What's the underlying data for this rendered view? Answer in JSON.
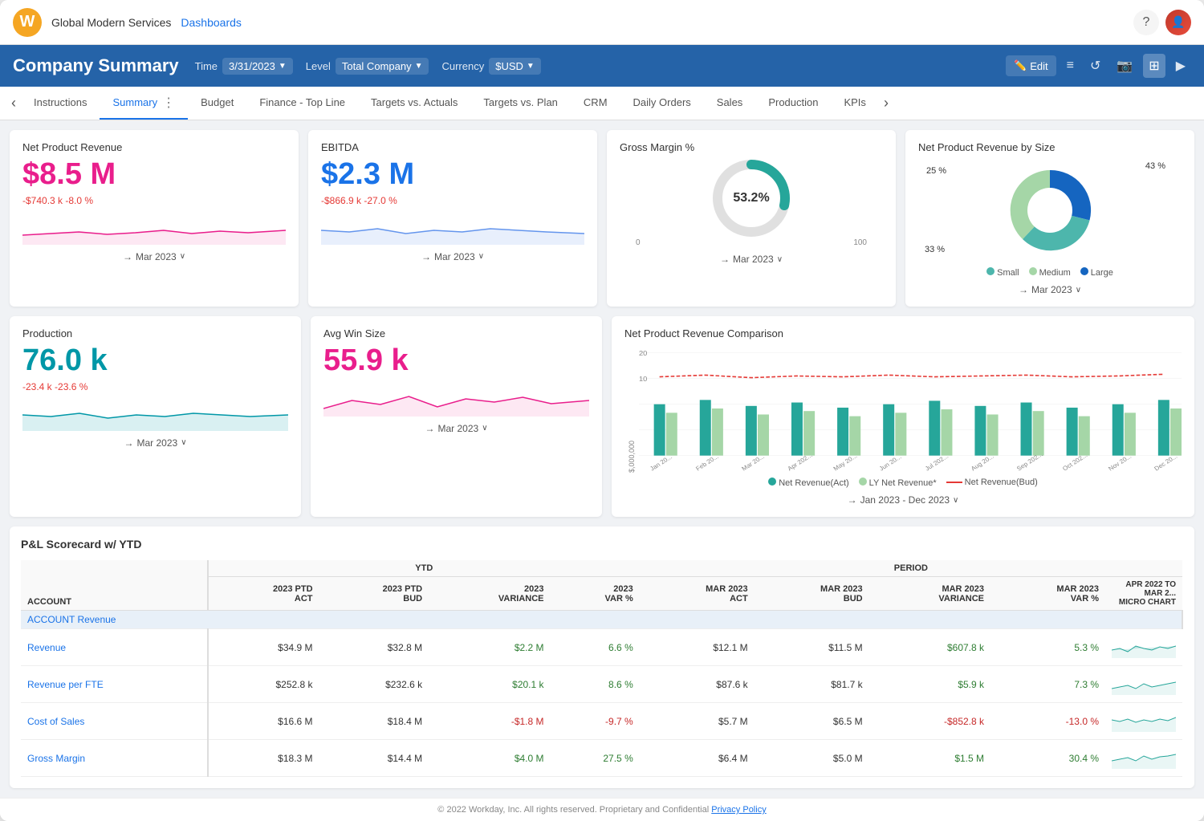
{
  "app": {
    "company": "Global Modern Services",
    "dashboards_link": "Dashboards"
  },
  "header": {
    "title": "Company Summary",
    "time_label": "Time",
    "time_value": "3/31/2023",
    "level_label": "Level",
    "level_value": "Total Company",
    "currency_label": "Currency",
    "currency_value": "$USD",
    "edit_label": "Edit",
    "icons": [
      "filter",
      "refresh",
      "camera",
      "grid",
      "video"
    ]
  },
  "tabs": [
    {
      "label": "Instructions",
      "active": false
    },
    {
      "label": "Summary",
      "active": true
    },
    {
      "label": "Budget",
      "active": false
    },
    {
      "label": "Finance - Top Line",
      "active": false
    },
    {
      "label": "Targets vs. Actuals",
      "active": false
    },
    {
      "label": "Targets vs. Plan",
      "active": false
    },
    {
      "label": "CRM",
      "active": false
    },
    {
      "label": "Daily Orders",
      "active": false
    },
    {
      "label": "Sales",
      "active": false
    },
    {
      "label": "Production",
      "active": false
    },
    {
      "label": "KPIs",
      "active": false
    }
  ],
  "widgets": {
    "net_product_revenue": {
      "title": "Net Product Revenue",
      "value": "$8.5 M",
      "delta1": "-$740.3 k",
      "delta2": "-8.0 %",
      "period": "Mar 2023"
    },
    "ebitda": {
      "title": "EBITDA",
      "value": "$2.3 M",
      "delta1": "-$866.9 k",
      "delta2": "-27.0 %",
      "period": "Mar 2023"
    },
    "gross_margin": {
      "title": "Gross Margin %",
      "value": "53.2%",
      "axis_min": "0",
      "axis_max": "100",
      "period": "Mar 2023"
    },
    "net_product_revenue_by_size": {
      "title": "Net Product Revenue by Size",
      "period": "Mar 2023",
      "segments": [
        {
          "label": "Small",
          "pct": 33,
          "color": "#4db6ac"
        },
        {
          "label": "Medium",
          "pct": 25,
          "color": "#a5d6a7"
        },
        {
          "label": "Large",
          "pct": 43,
          "color": "#1565c0"
        }
      ],
      "labels": {
        "top_right": "43 %",
        "top_left": "25 %",
        "bottom": "33 %"
      }
    },
    "production": {
      "title": "Production",
      "value": "76.0 k",
      "delta1": "-23.4 k",
      "delta2": "-23.6 %",
      "period": "Mar 2023"
    },
    "avg_win_size": {
      "title": "Avg Win Size",
      "value": "55.9 k",
      "period": "Mar 2023"
    },
    "net_product_revenue_comparison": {
      "title": "Net Product Revenue Comparison",
      "y_axis_label": "$,000,000",
      "y_max": 20,
      "period": "Jan 2023 - Dec 2023",
      "legend": [
        {
          "label": "Net Revenue(Act)",
          "color": "#26a69a",
          "type": "bar"
        },
        {
          "label": "LY Net Revenue*",
          "color": "#a5d6a7",
          "type": "bar"
        },
        {
          "label": "Net Revenue(Bud)",
          "color": "#e53935",
          "type": "line"
        }
      ],
      "months": [
        "Jan 20...",
        "Feb 20...",
        "Mar 20...",
        "Apr 202...",
        "May 20...",
        "Jun 20...",
        "Jul 202...",
        "Aug 20...",
        "Sep 202...",
        "Oct 202...",
        "Nov 20...",
        "Dec 20..."
      ]
    }
  },
  "pl_scorecard": {
    "title": "P&L Scorecard w/ YTD",
    "columns": {
      "ytd_label": "YTD",
      "period_label": "PERIOD",
      "headers": [
        "ACCOUNT",
        "2023 PTD ACT",
        "2023 PTD BUD",
        "2023 VARIANCE",
        "2023 VAR %",
        "MAR 2023 ACT",
        "MAR 2023 BUD",
        "MAR 2023 VARIANCE",
        "MAR 2023 VAR %",
        "APR 2022 TO MAR 2... MICRO CHART"
      ]
    },
    "account_label": "ACCOUNT Revenue",
    "rows": [
      {
        "account": "Revenue",
        "ytd_act": "$34.9 M",
        "ytd_bud": "$32.8 M",
        "ytd_var": "$2.2 M",
        "ytd_var_pct": "6.6 %",
        "period_act": "$12.1 M",
        "period_bud": "$11.5 M",
        "period_var": "$607.8 k",
        "period_var_pct": "5.3 %",
        "var_positive": true
      },
      {
        "account": "Revenue per FTE",
        "ytd_act": "$252.8 k",
        "ytd_bud": "$232.6 k",
        "ytd_var": "$20.1 k",
        "ytd_var_pct": "8.6 %",
        "period_act": "$87.6 k",
        "period_bud": "$81.7 k",
        "period_var": "$5.9 k",
        "period_var_pct": "7.3 %",
        "var_positive": true
      },
      {
        "account": "Cost of Sales",
        "ytd_act": "$16.6 M",
        "ytd_bud": "$18.4 M",
        "ytd_var": "-$1.8 M",
        "ytd_var_pct": "-9.7 %",
        "period_act": "$5.7 M",
        "period_bud": "$6.5 M",
        "period_var": "-$852.8 k",
        "period_var_pct": "-13.0 %",
        "var_positive": false
      },
      {
        "account": "Gross Margin",
        "ytd_act": "$18.3 M",
        "ytd_bud": "$14.4 M",
        "ytd_var": "$4.0 M",
        "ytd_var_pct": "27.5 %",
        "period_act": "$6.4 M",
        "period_bud": "$5.0 M",
        "period_var": "$1.5 M",
        "period_var_pct": "30.4 %",
        "var_positive": true
      }
    ]
  },
  "footer": {
    "copyright": "© 2022 Workday, Inc. All rights reserved. Proprietary and Confidential",
    "privacy_policy": "Privacy Policy"
  }
}
